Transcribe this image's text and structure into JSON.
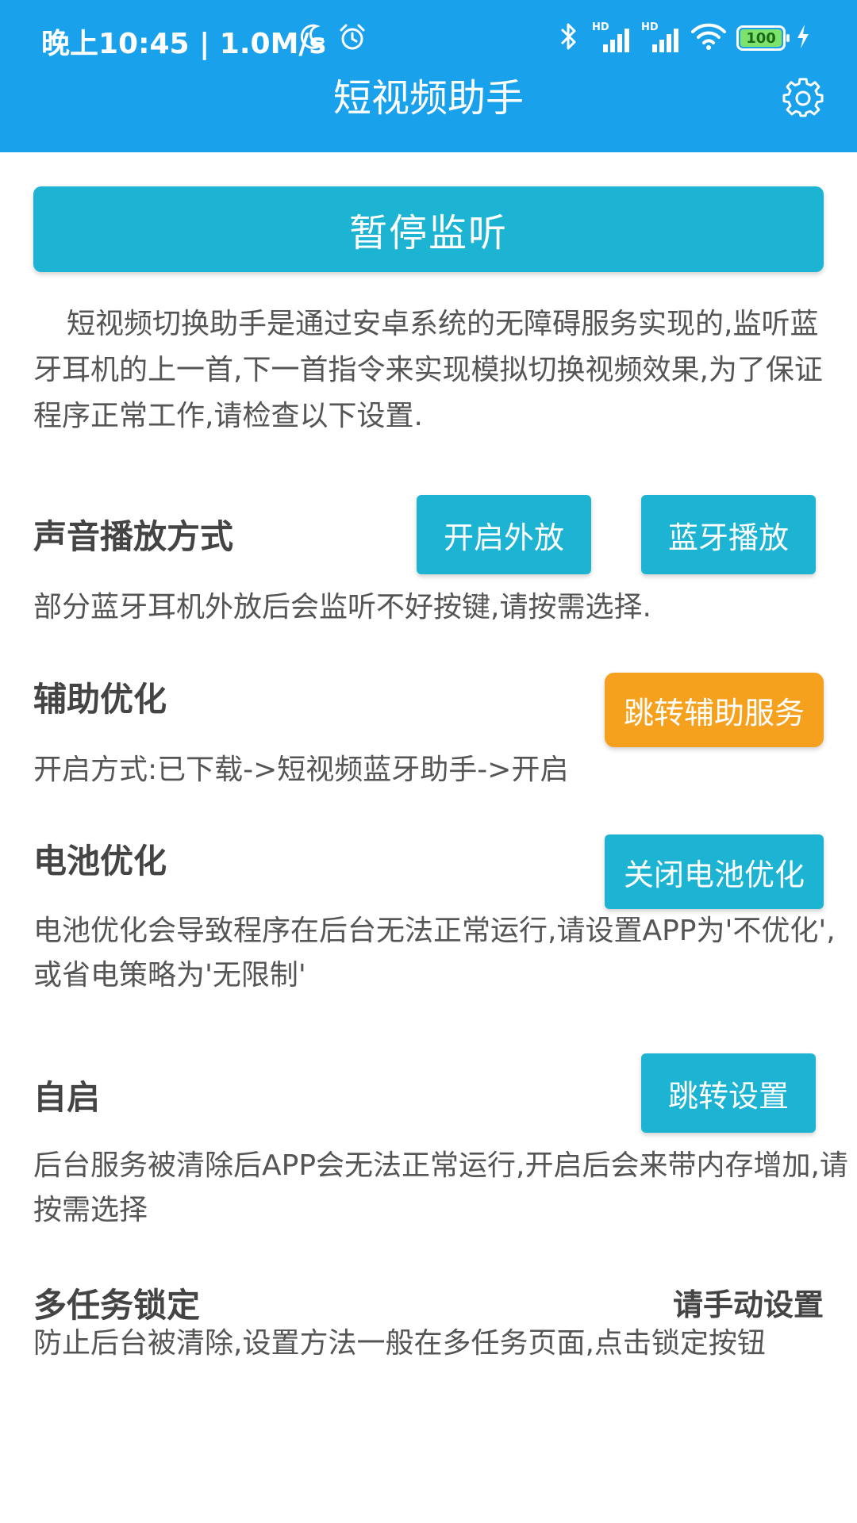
{
  "status_bar": {
    "time_speed": "晚上10:45 | 1.0M/s",
    "icons": [
      "moon-icon",
      "alarm-icon",
      "bluetooth-icon",
      "hd-signal-icon",
      "hd-signal-icon",
      "wifi-icon",
      "battery-icon",
      "charging-icon"
    ],
    "hd_label": "HD",
    "battery_level": "100"
  },
  "app_bar": {
    "title": "短视频助手",
    "settings_icon": "gear-icon"
  },
  "main": {
    "pause_button": "暂停监听",
    "intro": "短视频切换助手是通过安卓系统的无障碍服务实现的,监听蓝牙耳机的上一首,下一首指令来实现模拟切换视频效果,为了保证程序正常工作,请检查以下设置.",
    "sections": [
      {
        "title": "声音播放方式",
        "buttons": [
          "开启外放",
          "蓝牙播放"
        ],
        "desc": "部分蓝牙耳机外放后会监听不好按键,请按需选择."
      },
      {
        "title": "辅助优化",
        "button": "跳转辅助服务",
        "desc": "开启方式:已下载->短视频蓝牙助手->开启"
      },
      {
        "title": "电池优化",
        "button": "关闭电池优化",
        "desc": "电池优化会导致程序在后台无法正常运行,请设置APP为'不优化',或省电策略为'无限制'"
      },
      {
        "title": "自启",
        "button": "跳转设置",
        "desc": "后台服务被清除后APP会无法正常运行,开启后会来带内存增加,请按需选择"
      },
      {
        "title": "多任务锁定",
        "right_text": "请手动设置",
        "desc": "防止后台被清除,设置方法一般在多任务页面,点击锁定按钮"
      }
    ]
  },
  "colors": {
    "app_bar": "#1aa1ec",
    "primary_button": "#1db4d3",
    "accent_button": "#f5a11e"
  }
}
